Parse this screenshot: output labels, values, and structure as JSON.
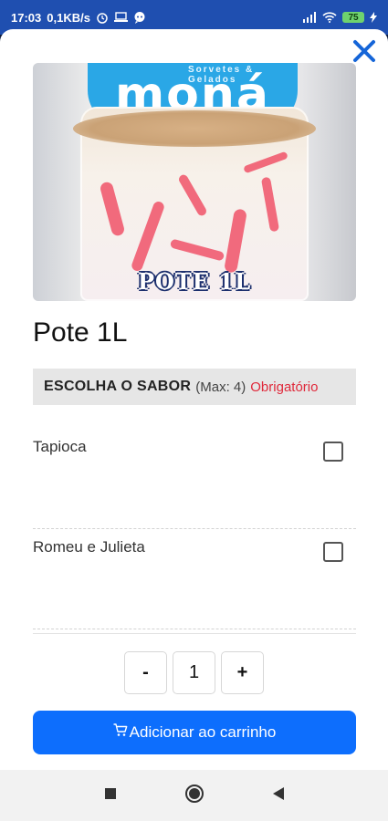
{
  "status_bar": {
    "time": "17:03",
    "speed": "0,1KB/s",
    "battery_level": "75",
    "icons": [
      "alarm-icon",
      "laptop-icon",
      "chat-icon",
      "signal-icon",
      "wifi-icon",
      "battery-icon",
      "charging-icon"
    ]
  },
  "modal": {
    "close_icon": "close-icon",
    "product_image": {
      "logo_top_text": "Sorvetes & Gelados",
      "logo_text": "moná",
      "label": "POTE 1L"
    },
    "product_title": "Pote 1L",
    "section": {
      "title": "ESCOLHA O SABOR",
      "max": "(Max: 4)",
      "required": "Obrigatório"
    },
    "options": [
      {
        "label": "Tapioca",
        "checked": false
      },
      {
        "label": "Romeu e Julieta",
        "checked": false
      }
    ],
    "quantity": {
      "minus": "-",
      "value": "1",
      "plus": "+"
    },
    "add_to_cart": "Adicionar ao carrinho"
  },
  "nav_bar": {
    "icons": [
      "recents-square-icon",
      "home-circle-icon",
      "back-triangle-icon"
    ]
  },
  "colors": {
    "status_bar": "#1f4fb0",
    "close_icon": "#1565d8",
    "primary_button": "#0d6efd",
    "required": "#e0293b"
  }
}
